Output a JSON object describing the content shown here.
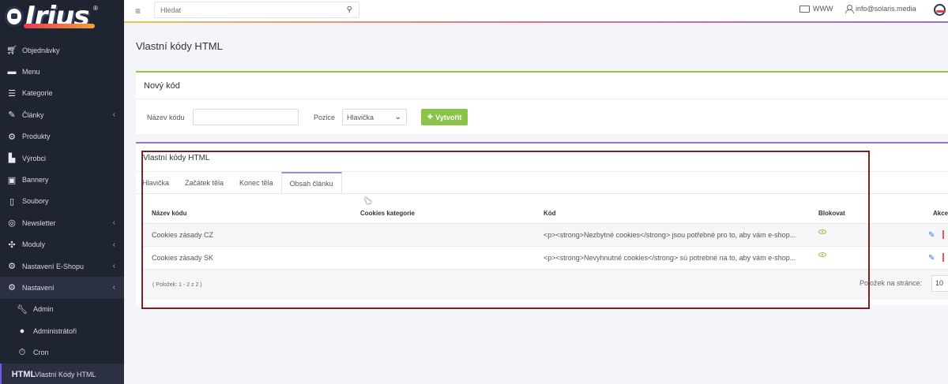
{
  "sidebar": {
    "items": [
      {
        "label": "Objednávky",
        "icon": "cart-icon",
        "chev": ""
      },
      {
        "label": "Menu",
        "icon": "folder-icon",
        "chev": ""
      },
      {
        "label": "Kategorie",
        "icon": "list-icon",
        "chev": ""
      },
      {
        "label": "Články",
        "icon": "pencil-icon",
        "chev": "‹"
      },
      {
        "label": "Produkty",
        "icon": "box-icon",
        "chev": ""
      },
      {
        "label": "Výrobci",
        "icon": "factory-icon",
        "chev": ""
      },
      {
        "label": "Bannery",
        "icon": "image-icon",
        "chev": ""
      },
      {
        "label": "Soubory",
        "icon": "file-icon",
        "chev": ""
      },
      {
        "label": "Newsletter",
        "icon": "newsletter-icon",
        "chev": "‹"
      },
      {
        "label": "Moduly",
        "icon": "puzzle-icon",
        "chev": "‹"
      },
      {
        "label": "Nastavení E-Shopu",
        "icon": "cogs-icon",
        "chev": "‹"
      },
      {
        "label": "Nastavení",
        "icon": "cogs-icon",
        "chev": "‹"
      }
    ],
    "subitems": [
      {
        "label": "Admin",
        "icon": "wrench-icon"
      },
      {
        "label": "Administrátoři",
        "icon": "user-icon"
      },
      {
        "label": "Cron",
        "icon": "stopwatch-icon"
      },
      {
        "label": "Vlastní Kódy HTML",
        "icon": "html-icon",
        "icon_text": "HTML"
      }
    ]
  },
  "topbar": {
    "search_placeholder": "Hledat",
    "www_label": "WWW",
    "user_email": "info@solaris.media"
  },
  "logo": {
    "text": "Irius",
    "reg": "®"
  },
  "page": {
    "title": "Vlastní kódy HTML"
  },
  "new_code": {
    "heading": "Nový kód",
    "name_label": "Název kódu",
    "position_label": "Pozice",
    "position_value": "Hlavička",
    "create_label": "Vytvořit"
  },
  "codes": {
    "heading": "Vlastní kódy HTML",
    "tabs": [
      "Hlavička",
      "Začátek těla",
      "Konec těla",
      "Obsah článku"
    ],
    "active_tab": "Obsah článku",
    "columns": {
      "name": "Název kódu",
      "cookies": "Cookies kategorie",
      "code": "Kód",
      "block": "Blokovat",
      "actions": "Akce"
    },
    "rows": [
      {
        "name": "Cookies zásady CZ",
        "cookies": "",
        "code": "<p><strong>Nezbytné cookies</strong> jsou potřebné pro to, aby vám e-shop..."
      },
      {
        "name": "Cookies zásady SK",
        "cookies": "",
        "code": "<p><strong>Nevyhnutné cookies</strong> sú potrebné na to, aby vám e-shop..."
      }
    ],
    "count_text": "( Položek: 1 - 2 z 2 )",
    "per_page_label": "Položek na stránce:",
    "per_page_value": "10"
  },
  "colors": {
    "sidebar_bg": "#1f2431",
    "accent_green": "#8bc34a",
    "accent_purple": "#9b6ed8",
    "highlight_border": "#7a2222"
  }
}
